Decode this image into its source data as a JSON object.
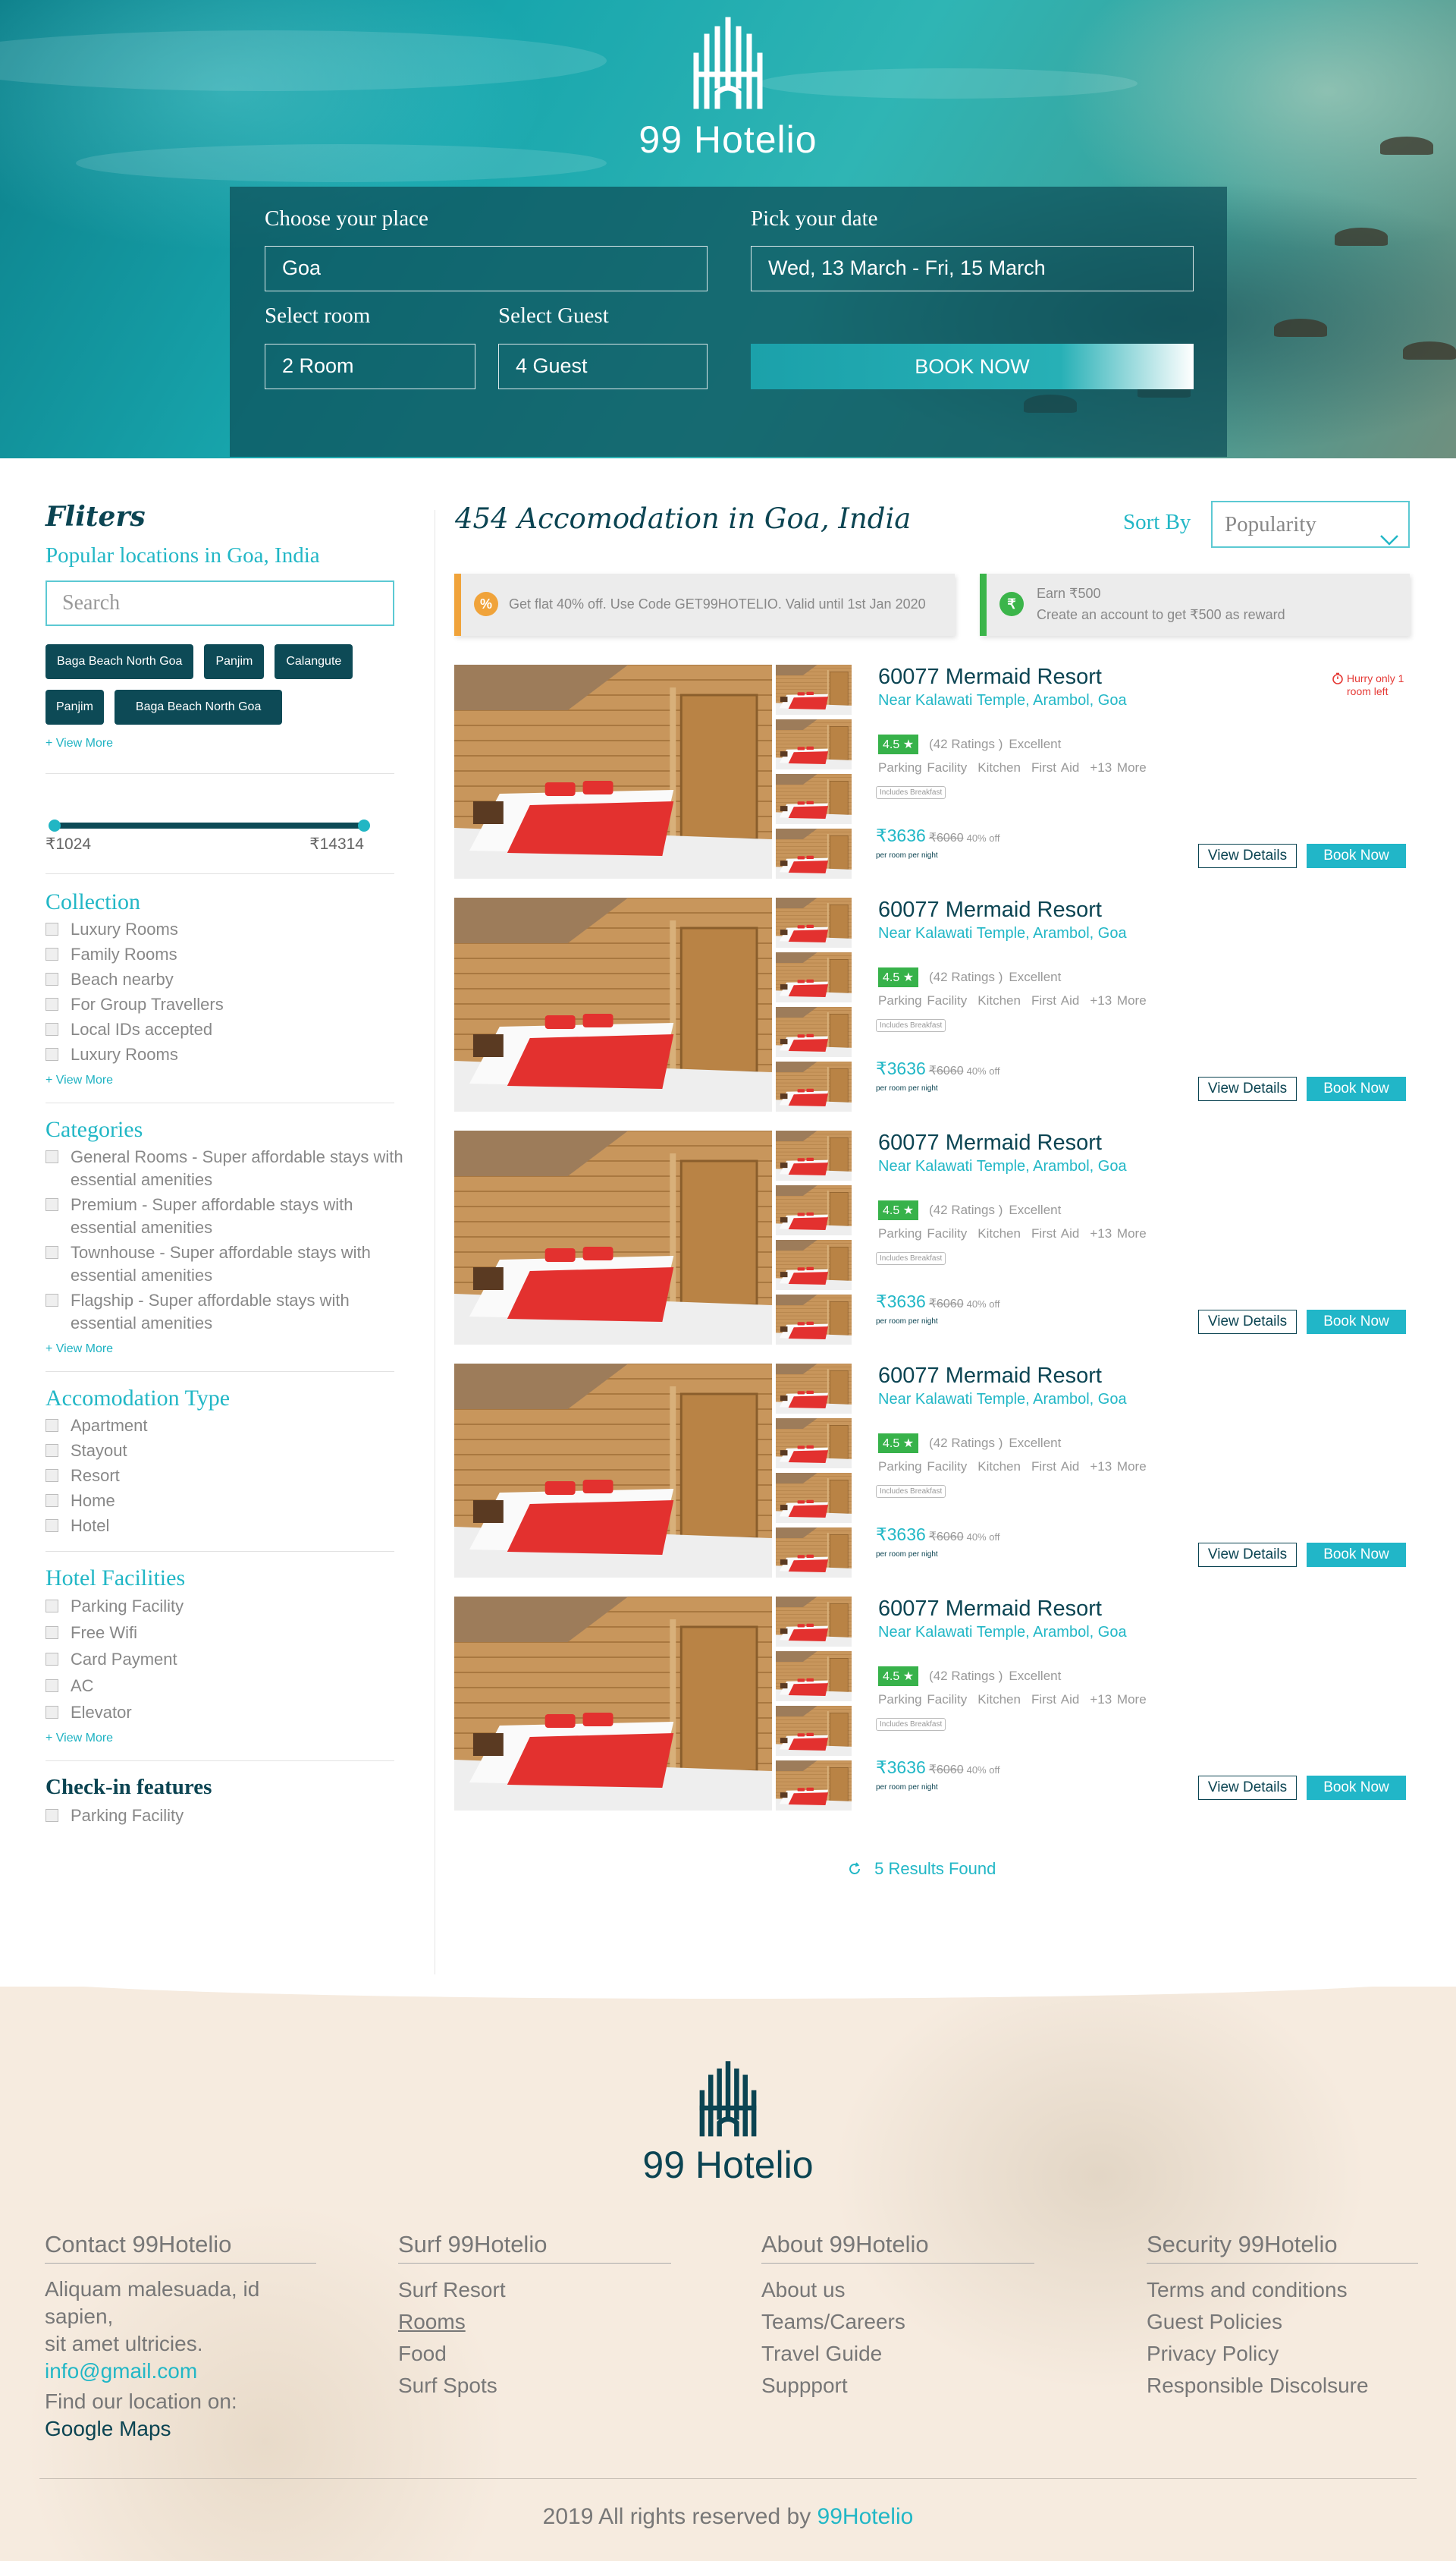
{
  "brand": {
    "name": "99 Hotelio"
  },
  "booking": {
    "place_label": "Choose your place",
    "place_value": "Goa",
    "date_label": "Pick your date",
    "date_value": "Wed, 13 March - Fri, 15 March",
    "room_label": "Select room",
    "room_value": "2 Room",
    "guest_label": "Select Guest",
    "guest_value": "4 Guest",
    "book_label": "BOOK NOW"
  },
  "filters": {
    "title": "Fliters",
    "subtitle": "Popular locations in Goa, India",
    "search_placeholder": "Search",
    "tags": [
      "Baga Beach North Goa",
      "Panjim",
      "Calangute",
      "Panjim",
      "Baga Beach North Goa"
    ],
    "view_more": "+ View More",
    "price_min": "₹1024",
    "price_max": "₹14314",
    "collection": {
      "title": "Collection",
      "items": [
        "Luxury Rooms",
        "Family Rooms",
        "Beach nearby",
        "For Group Travellers",
        "Local IDs accepted",
        "Luxury Rooms"
      ],
      "more": "+ View More"
    },
    "categories": {
      "title": "Categories",
      "items": [
        "General Rooms - Super affordable stays with essential amenities",
        "Premium - Super affordable stays with essential amenities",
        "Townhouse - Super affordable stays with essential amenities",
        "Flagship - Super affordable stays with essential amenities"
      ],
      "more": "+ View More"
    },
    "accommodation": {
      "title": "Accomodation Type",
      "items": [
        "Apartment",
        "Stayout",
        "Resort",
        "Home",
        "Hotel"
      ]
    },
    "facilities": {
      "title": "Hotel Facilities",
      "items": [
        "Parking Facility",
        "Free Wifi",
        "Card Payment",
        "AC",
        "Elevator"
      ],
      "more": "+ View More"
    },
    "checkin": {
      "title": "Check-in features",
      "items": [
        "Parking Facility"
      ]
    }
  },
  "listing": {
    "title": "454 Accomodation in Goa, India",
    "sort_label": "Sort By",
    "sort_value": "Popularity",
    "promo1": "Get flat 40% off. Use Code GET99HOTELIO. Valid until 1st Jan 2020",
    "promo2_line1": "Earn  ₹500",
    "promo2_line2": "Create an account to get ₹500 as reward",
    "results": "5 Results Found"
  },
  "hotels": [
    {
      "name": "60077 Mermaid Resort",
      "location": "Near Kalawati Temple, Arambol, Goa",
      "rating": "4.5 ★",
      "ratings_count": "(42 Ratings )",
      "rating_word": "Excellent",
      "facilities": [
        "Parking Facility",
        "Kitchen",
        "First Aid",
        "+13 More"
      ],
      "breakfast": "Includes Breakfast",
      "price": "₹3636",
      "old_price": "₹6060",
      "discount": "40% off",
      "per_room": "per room per night",
      "hurry": "Hurry only 1 room left",
      "view": "View Details",
      "book": "Book Now"
    },
    {
      "name": "60077 Mermaid Resort",
      "location": "Near Kalawati Temple, Arambol, Goa",
      "rating": "4.5 ★",
      "ratings_count": "(42 Ratings )",
      "rating_word": "Excellent",
      "facilities": [
        "Parking Facility",
        "Kitchen",
        "First Aid",
        "+13 More"
      ],
      "breakfast": "Includes Breakfast",
      "price": "₹3636",
      "old_price": "₹6060",
      "discount": "40% off",
      "per_room": "per room per night",
      "view": "View Details",
      "book": "Book Now"
    },
    {
      "name": "60077 Mermaid Resort",
      "location": "Near Kalawati Temple, Arambol, Goa",
      "rating": "4.5 ★",
      "ratings_count": "(42 Ratings )",
      "rating_word": "Excellent",
      "facilities": [
        "Parking Facility",
        "Kitchen",
        "First Aid",
        "+13 More"
      ],
      "breakfast": "Includes Breakfast",
      "price": "₹3636",
      "old_price": "₹6060",
      "discount": "40% off",
      "per_room": "per room per night",
      "view": "View Details",
      "book": "Book Now"
    },
    {
      "name": "60077 Mermaid Resort",
      "location": "Near Kalawati Temple, Arambol, Goa",
      "rating": "4.5 ★",
      "ratings_count": "(42 Ratings )",
      "rating_word": "Excellent",
      "facilities": [
        "Parking Facility",
        "Kitchen",
        "First Aid",
        "+13 More"
      ],
      "breakfast": "Includes Breakfast",
      "price": "₹3636",
      "old_price": "₹6060",
      "discount": "40% off",
      "per_room": "per room per night",
      "view": "View Details",
      "book": "Book Now"
    },
    {
      "name": "60077 Mermaid Resort",
      "location": "Near Kalawati Temple, Arambol, Goa",
      "rating": "4.5 ★",
      "ratings_count": "(42 Ratings )",
      "rating_word": "Excellent",
      "facilities": [
        "Parking Facility",
        "Kitchen",
        "First Aid",
        "+13 More"
      ],
      "breakfast": "Includes Breakfast",
      "price": "₹3636",
      "old_price": "₹6060",
      "discount": "40% off",
      "per_room": "per room per night",
      "view": "View Details",
      "book": "Book Now"
    }
  ],
  "footer": {
    "brand": "99 Hotelio",
    "contact": {
      "title": "Contact 99Hotelio",
      "line1": "Aliquam malesuada, id sapien,",
      "line2": "sit amet ultricies.",
      "email": "info@gmail.com",
      "find": "Find our location on:",
      "maps": "Google Maps"
    },
    "surf": {
      "title": "Surf 99Hotelio",
      "links": [
        "Surf Resort",
        "Rooms",
        "Food",
        "Surf Spots"
      ]
    },
    "about": {
      "title": "About 99Hotelio",
      "links": [
        "About us",
        "Teams/Careers",
        "Travel Guide",
        "Suppport"
      ]
    },
    "security": {
      "title": "Security 99Hotelio",
      "links": [
        "Terms and conditions",
        "Guest Policies",
        "Privacy Policy",
        "Responsible Discolsure"
      ]
    },
    "copyright_prefix": "2019 All rights reserved by ",
    "copyright_brand": "99Hotelio"
  },
  "colors": {
    "accent": "#22b7c6",
    "dark": "#0b4452",
    "rating_green": "#37b24a",
    "promo_orange": "#f0a33a",
    "promo_green": "#3bb54a",
    "hurry_red": "#e53935"
  },
  "icons": {
    "brand_logo": "hotel-bars-logo-icon",
    "sort_chevron": "chevron-down-icon",
    "promo1": "percent-badge-icon",
    "promo2": "rupee-badge-icon",
    "hurry": "timer-icon",
    "results": "refresh-icon",
    "star": "star-icon"
  }
}
